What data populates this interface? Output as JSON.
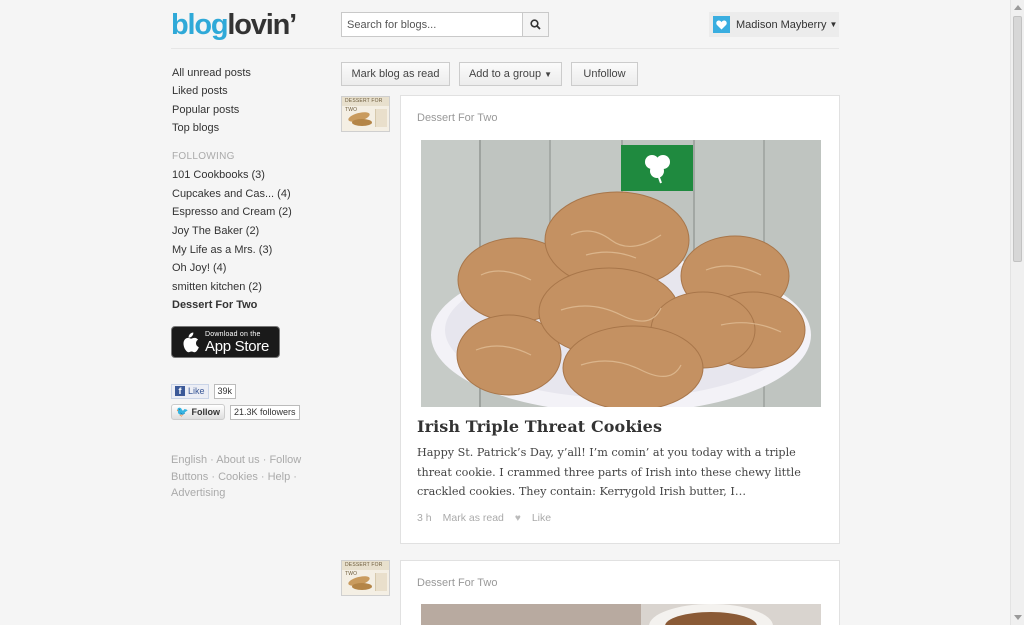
{
  "header": {
    "logo_blog": "blog",
    "logo_lovin": "lovin’",
    "search_placeholder": "Search for blogs...",
    "user_name": "Madison Mayberry"
  },
  "sidebar": {
    "nav": [
      "All unread posts",
      "Liked posts",
      "Popular posts",
      "Top blogs"
    ],
    "following_label": "FOLLOWING",
    "following": [
      "101 Cookbooks (3)",
      "Cupcakes and Cas... (4)",
      "Espresso and Cream (2)",
      "Joy The Baker (2)",
      "My Life as a Mrs. (3)",
      "Oh Joy! (4)",
      "smitten kitchen (2)",
      "Dessert For Two"
    ],
    "appstore_small": "Download on the",
    "appstore_big": "App Store",
    "fb_like": "Like",
    "fb_count": "39k",
    "tw_follow": "Follow",
    "tw_followers": "21.3K followers",
    "footer": "English · About us · Follow Buttons · Cookies · Help · Advertising"
  },
  "toolbar": {
    "mark_read": "Mark blog as read",
    "add_group": "Add to a group",
    "unfollow": "Unfollow"
  },
  "posts": [
    {
      "thumb_label": "DESSERT FOR TWO",
      "blog": "Dessert For Two",
      "title": "Irish Triple Threat Cookies",
      "excerpt": "Happy St. Patrick’s Day, y’all! I’m comin’ at you today with a triple threat cookie. I crammed three parts of Irish into these chewy little crackled cookies. They contain: Kerrygold Irish butter, I…",
      "time": "3 h",
      "mark_read": "Mark as read",
      "like": "Like"
    },
    {
      "thumb_label": "DESSERT FOR TWO",
      "blog": "Dessert For Two"
    }
  ],
  "colors": {
    "brand_blue": "#2fa9d8",
    "background": "#f5f5f5",
    "card": "#ffffff"
  }
}
